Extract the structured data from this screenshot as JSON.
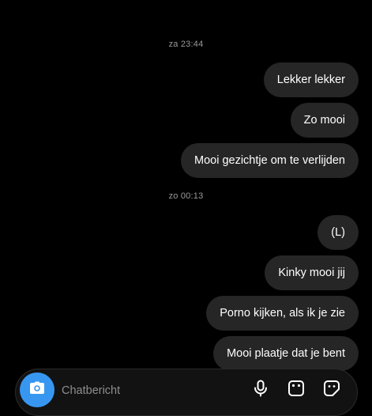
{
  "thread": {
    "groups": [
      {
        "timestamp": "za 23:44",
        "messages": [
          "Lekker lekker",
          "Zo mooi",
          "Mooi gezichtje om te verlijden"
        ]
      },
      {
        "timestamp": "zo 00:13",
        "messages": [
          "(L)",
          "Kinky mooi jij",
          "Porno kijken, als ik je zie",
          "Mooi plaatje dat je bent"
        ]
      }
    ]
  },
  "composer": {
    "placeholder": "Chatbericht",
    "icons": [
      "camera-icon",
      "microphone-icon",
      "gallery-icon",
      "sticker-icon"
    ],
    "camera_color": "#3797f0"
  },
  "colors": {
    "background": "#000000",
    "bubble": "#262626",
    "timestamp": "#9a9a9a"
  }
}
